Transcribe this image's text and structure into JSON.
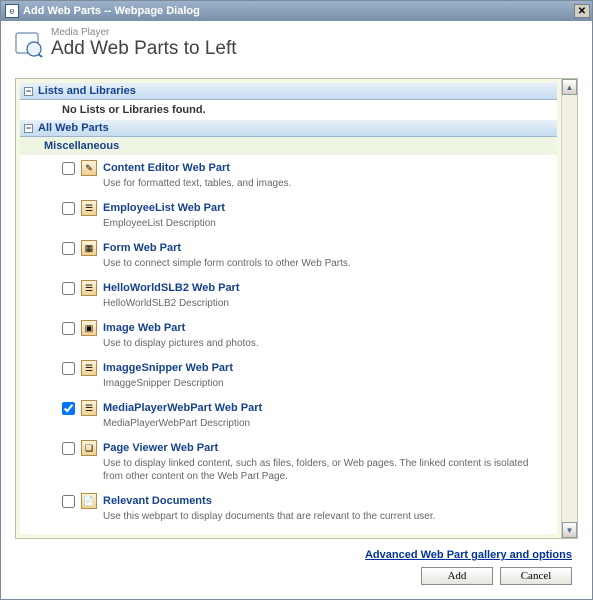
{
  "window": {
    "title": "Add Web Parts -- Webpage Dialog"
  },
  "header": {
    "subtitle": "Media Player",
    "title": "Add Web Parts to Left"
  },
  "sections": {
    "lists": {
      "label": "Lists and Libraries",
      "empty": "No Lists or Libraries found."
    },
    "all": {
      "label": "All Web Parts",
      "group": "Miscellaneous"
    }
  },
  "items": [
    {
      "title": "Content Editor Web Part",
      "desc": "Use for formatted text, tables, and images.",
      "checked": false,
      "glyph": "✎"
    },
    {
      "title": "EmployeeList Web Part",
      "desc": "EmployeeList Description",
      "checked": false,
      "glyph": "☰"
    },
    {
      "title": "Form Web Part",
      "desc": "Use to connect simple form controls to other Web Parts.",
      "checked": false,
      "glyph": "▦"
    },
    {
      "title": "HelloWorldSLB2 Web Part",
      "desc": "HelloWorldSLB2 Description",
      "checked": false,
      "glyph": "☰"
    },
    {
      "title": "Image Web Part",
      "desc": "Use to display pictures and photos.",
      "checked": false,
      "glyph": "▣"
    },
    {
      "title": "ImaggeSnipper Web Part",
      "desc": "ImaggeSnipper Description",
      "checked": false,
      "glyph": "☰"
    },
    {
      "title": "MediaPlayerWebPart Web Part",
      "desc": "MediaPlayerWebPart Description",
      "checked": true,
      "glyph": "☰"
    },
    {
      "title": "Page Viewer Web Part",
      "desc": "Use to display linked content, such as files, folders, or Web pages. The linked content is isolated from other content on the Web Part Page.",
      "checked": false,
      "glyph": "❏"
    },
    {
      "title": "Relevant Documents",
      "desc": "Use this webpart to display documents that are relevant to the current user.",
      "checked": false,
      "glyph": "📄"
    }
  ],
  "footer": {
    "advanced": "Advanced Web Part gallery and options",
    "add": "Add",
    "cancel": "Cancel"
  }
}
